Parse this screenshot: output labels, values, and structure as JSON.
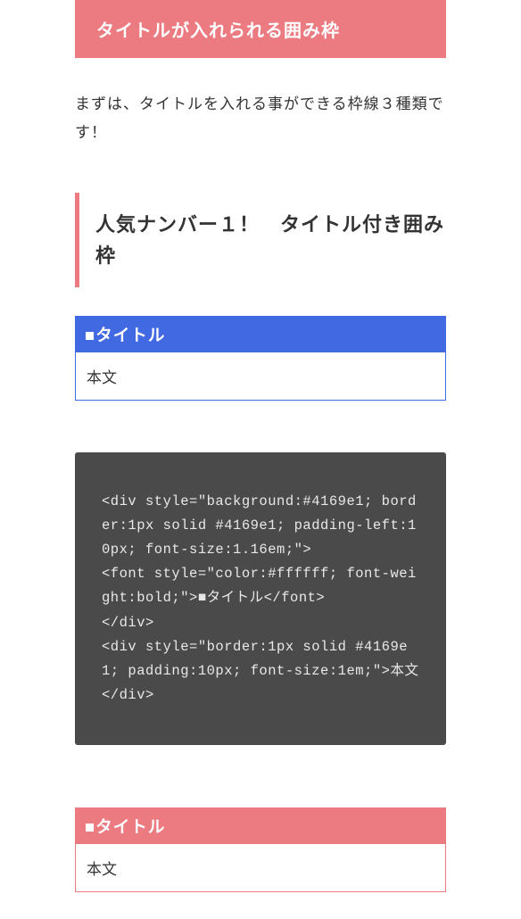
{
  "header": {
    "title": "タイトルが入れられる囲み枠"
  },
  "intro": "まずは、タイトルを入れる事ができる枠線３種類です！",
  "subtitle": "人気ナンバー１！　タイトル付き囲み枠",
  "box1": {
    "title": "■タイトル",
    "body": "本文"
  },
  "code": "<div style=\"background:#4169e1; border:1px solid #4169e1; padding-left:10px; font-size:1.16em;\">\n<font style=\"color:#ffffff; font-weight:bold;\">■タイトル</font>\n</div>\n<div style=\"border:1px solid #4169e1; padding:10px; font-size:1em;\">本文</div>",
  "box2": {
    "title": "■タイトル",
    "body": "本文"
  }
}
